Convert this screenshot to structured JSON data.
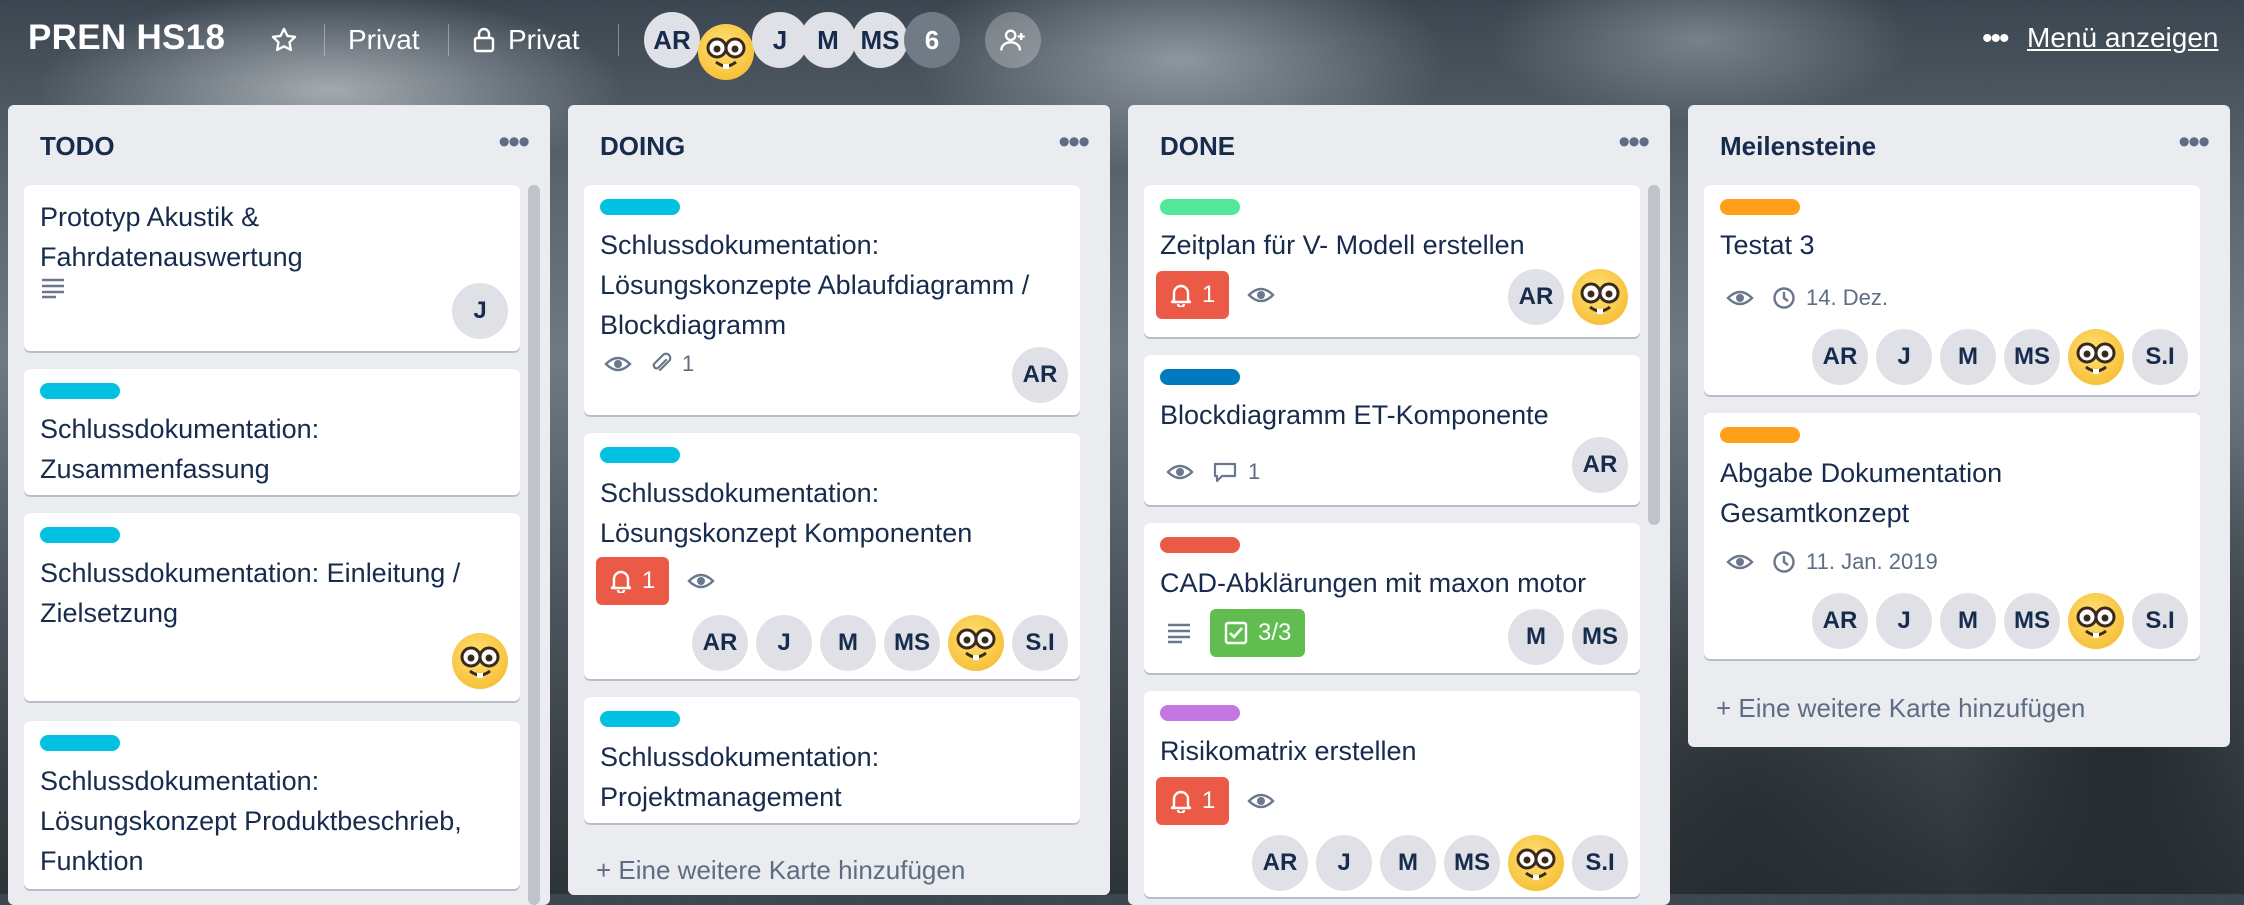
{
  "colors": {
    "label_cyan": "#00c2e0",
    "label_green": "#51e898",
    "label_blue": "#0079bf",
    "label_red": "#eb5a46",
    "label_purple": "#c377e0",
    "label_orange": "#ff9f1a",
    "badge_red": "#eb5a46",
    "badge_green": "#61bd4f"
  },
  "header": {
    "board_title": "PREN HS18",
    "star_icon": "star-icon",
    "visibility_team": "Privat",
    "visibility_private": "Privat",
    "members": [
      "AR",
      "emoji",
      "J",
      "M",
      "MS"
    ],
    "more_count": "6",
    "menu_label": "Menü anzeigen"
  },
  "lists": [
    {
      "title": "TODO",
      "cards": [
        {
          "title": "Prototyp Akustik & Fahrdatenauswertung",
          "members": [
            "J"
          ]
        },
        {
          "title": "Schlussdokumentation: Zusammenfassung",
          "label": "cyan"
        },
        {
          "title": "Schlussdokumentation: Einleitung / Zielsetzung",
          "label": "cyan",
          "members": [
            "emoji"
          ]
        },
        {
          "title": "Schlussdokumentation: Lösungskonzept Produktbeschrieb, Funktion",
          "label": "cyan"
        }
      ]
    },
    {
      "title": "DOING",
      "cards": [
        {
          "title": "Schlussdokumentation: Lösungskonzepte Ablaufdiagramm / Blockdiagramm",
          "label": "cyan",
          "attachments": "1",
          "members": [
            "AR"
          ]
        },
        {
          "title": "Schlussdokumentation: Lösungskonzept Komponenten",
          "label": "cyan",
          "notifications": "1",
          "members": [
            "AR",
            "J",
            "M",
            "MS",
            "emoji",
            "S.I"
          ]
        },
        {
          "title": "Schlussdokumentation: Projektmanagement",
          "label": "cyan"
        }
      ],
      "add_card": "Eine weitere Karte hinzufügen"
    },
    {
      "title": "DONE",
      "cards": [
        {
          "title": "Zeitplan für V- Modell erstellen",
          "label": "green",
          "notifications": "1",
          "members": [
            "AR",
            "emoji"
          ]
        },
        {
          "title": "Blockdiagramm ET-Komponente",
          "label": "blue",
          "comments": "1",
          "members": [
            "AR"
          ]
        },
        {
          "title": "CAD-Abklärungen mit maxon motor",
          "label": "red",
          "checklist": "3/3",
          "members": [
            "M",
            "MS"
          ]
        },
        {
          "title": "Risikomatrix erstellen",
          "label": "purple",
          "notifications": "1",
          "members": [
            "AR",
            "J",
            "M",
            "MS",
            "emoji",
            "S.I"
          ]
        }
      ]
    },
    {
      "title": "Meilensteine",
      "cards": [
        {
          "title": "Testat 3",
          "label": "orange",
          "due": "14. Dez.",
          "members": [
            "AR",
            "J",
            "M",
            "MS",
            "emoji",
            "S.I"
          ]
        },
        {
          "title": "Abgabe Dokumentation Gesamtkonzept",
          "label": "orange",
          "due": "11. Jan. 2019",
          "members": [
            "AR",
            "J",
            "M",
            "MS",
            "emoji",
            "S.I"
          ]
        }
      ],
      "add_card": "Eine weitere Karte hinzufügen"
    }
  ]
}
